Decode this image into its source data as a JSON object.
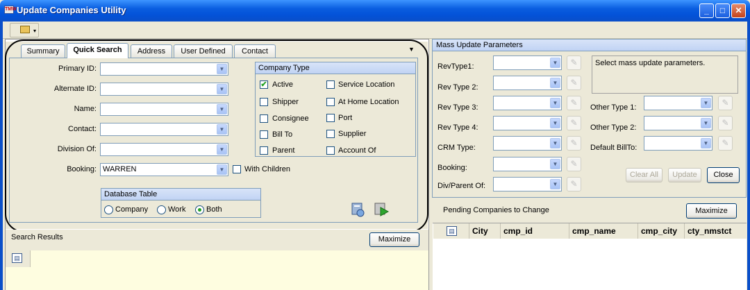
{
  "window": {
    "title": "Update Companies Utility",
    "icon": "app-icon",
    "min_icon": "minimize-icon",
    "max_icon": "maximize-icon",
    "close_icon": "close-icon"
  },
  "toolbar": {
    "button_icon": "folder-up-icon",
    "dropdown_icon": "dropdown-arrow-icon"
  },
  "tabs": [
    {
      "label": "Summary"
    },
    {
      "label": "Quick Search"
    },
    {
      "label": "Address"
    },
    {
      "label": "User Defined"
    },
    {
      "label": "Contact"
    }
  ],
  "active_tab": "Quick Search",
  "quick_search": {
    "fields": [
      {
        "label": "Primary ID:",
        "value": ""
      },
      {
        "label": "Alternate ID:",
        "value": ""
      },
      {
        "label": "Name:",
        "value": ""
      },
      {
        "label": "Contact:",
        "value": ""
      },
      {
        "label": "Division Of:",
        "value": ""
      },
      {
        "label": "Booking:",
        "value": "WARREN"
      }
    ],
    "with_children": {
      "label": "With Children",
      "checked": false
    },
    "company_type": {
      "title": "Company Type",
      "items": [
        {
          "label": "Active",
          "checked": true
        },
        {
          "label": "Service Location",
          "checked": false
        },
        {
          "label": "Shipper",
          "checked": false
        },
        {
          "label": "At Home Location",
          "checked": false
        },
        {
          "label": "Consignee",
          "checked": false
        },
        {
          "label": "Port",
          "checked": false
        },
        {
          "label": "Bill To",
          "checked": false
        },
        {
          "label": "Supplier",
          "checked": false
        },
        {
          "label": "Parent",
          "checked": false
        },
        {
          "label": "Account Of",
          "checked": false
        }
      ]
    },
    "database_table": {
      "title": "Database Table",
      "options": [
        {
          "label": "Company",
          "selected": false
        },
        {
          "label": "Work",
          "selected": false
        },
        {
          "label": "Both",
          "selected": true
        }
      ]
    }
  },
  "search_results": {
    "title": "Search Results",
    "maximize": "Maximize",
    "grid_icon": "grid-settings-icon"
  },
  "mass_update": {
    "title": "Mass Update Parameters",
    "left_fields": [
      {
        "label": "RevType1:",
        "value": ""
      },
      {
        "label": "Rev Type 2:",
        "value": ""
      },
      {
        "label": "Rev Type 3:",
        "value": ""
      },
      {
        "label": "Rev Type 4:",
        "value": ""
      },
      {
        "label": "CRM Type:",
        "value": ""
      },
      {
        "label": "Booking:",
        "value": ""
      },
      {
        "label": "Div/Parent Of:",
        "value": ""
      }
    ],
    "right_fields": [
      {
        "label": "Other Type 1:",
        "value": ""
      },
      {
        "label": "Other Type 2:",
        "value": ""
      },
      {
        "label": "Default BillTo:",
        "value": ""
      }
    ],
    "message": "Select mass update parameters.",
    "clear_all": "Clear All",
    "update": "Update",
    "close": "Close"
  },
  "pending": {
    "title": "Pending Companies to Change",
    "maximize": "Maximize",
    "columns": [
      "City",
      "cmp_id",
      "cmp_name",
      "cmp_city",
      "cty_nmstct"
    ]
  }
}
